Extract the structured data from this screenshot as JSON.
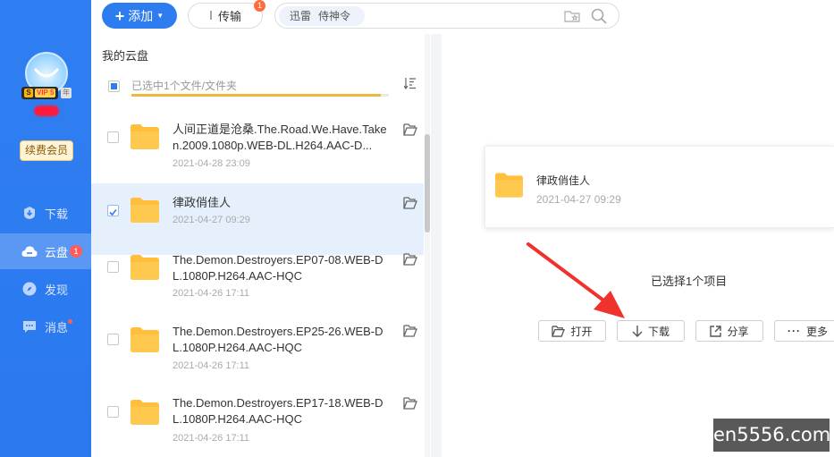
{
  "sidebar": {
    "vip_label": "VIP 5",
    "vip_year": "年",
    "renew_label": "续费会员",
    "items": [
      {
        "label": "下载",
        "icon": "download-icon"
      },
      {
        "label": "云盘",
        "icon": "cloud-icon",
        "badge": "1",
        "active": true
      },
      {
        "label": "发现",
        "icon": "compass-icon"
      },
      {
        "label": "消息",
        "icon": "message-icon",
        "dot": true
      }
    ]
  },
  "toolbar": {
    "add_label": "添加",
    "transfer_label": "传输",
    "transfer_badge": "1",
    "search_tags": [
      "迅雷",
      "侍神令"
    ]
  },
  "list": {
    "title": "我的云盘",
    "selection_text": "已选中1个文件/文件夹",
    "selection_progress": 0.97,
    "files": [
      {
        "name": "人间正道是沧桑.The.Road.We.Have.Taken.2009.1080p.WEB-DL.H264.AAC-D...",
        "date": "2021-04-28 23:09",
        "checked": false
      },
      {
        "name": "律政俏佳人",
        "date": "2021-04-27 09:29",
        "checked": true
      },
      {
        "name": "The.Demon.Destroyers.EP07-08.WEB-DL.1080P.H264.AAC-HQC",
        "date": "2021-04-26 17:11",
        "checked": false
      },
      {
        "name": "The.Demon.Destroyers.EP25-26.WEB-DL.1080P.H264.AAC-HQC",
        "date": "2021-04-26 17:11",
        "checked": false
      },
      {
        "name": "The.Demon.Destroyers.EP17-18.WEB-DL.1080P.H264.AAC-HQC",
        "date": "2021-04-26 17:11",
        "checked": false
      }
    ]
  },
  "detail": {
    "name": "律政俏佳人",
    "date": "2021-04-27 09:29",
    "count_text": "已选择1个项目",
    "actions": [
      "打开",
      "下载",
      "分享",
      "更多"
    ]
  },
  "colors": {
    "brand": "#2d7cf0",
    "folder": "#ffbf3c",
    "annotation_arrow": "#f0322d"
  },
  "watermark": "en5556.com"
}
